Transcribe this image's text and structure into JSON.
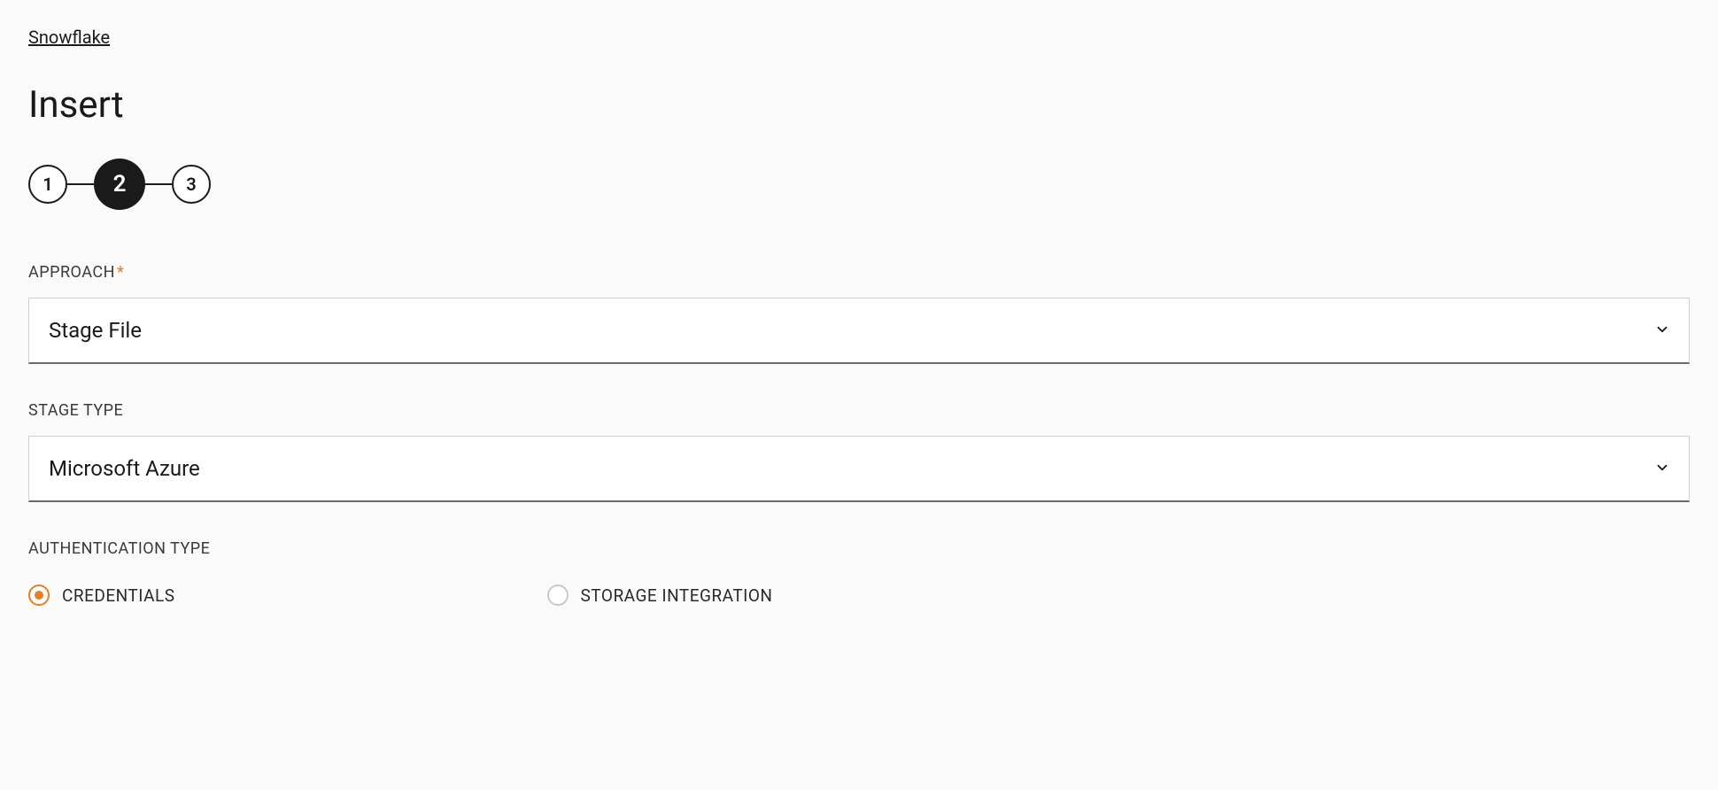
{
  "breadcrumb": {
    "text": "Snowflake"
  },
  "page": {
    "title": "Insert"
  },
  "stepper": {
    "steps": [
      "1",
      "2",
      "3"
    ],
    "active_index": 1
  },
  "form": {
    "approach": {
      "label": "APPROACH",
      "required": true,
      "value": "Stage File"
    },
    "stage_type": {
      "label": "STAGE TYPE",
      "required": false,
      "value": "Microsoft Azure"
    },
    "authentication_type": {
      "label": "AUTHENTICATION TYPE",
      "options": [
        {
          "label": "CREDENTIALS",
          "selected": true
        },
        {
          "label": "STORAGE INTEGRATION",
          "selected": false
        }
      ]
    }
  }
}
